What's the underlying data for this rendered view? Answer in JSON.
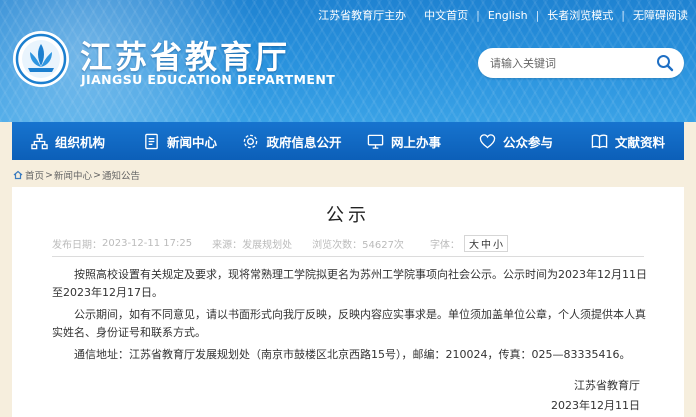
{
  "topbar": {
    "links": [
      "江苏省教育厅主办",
      "中文首页",
      "English",
      "长者浏览模式",
      "无障碍阅读"
    ]
  },
  "brand": {
    "name_cn": "江苏省教育厅",
    "name_en": "JIANGSU EDUCATION DEPARTMENT",
    "logo_icon": "lotus-emblem-icon"
  },
  "search": {
    "placeholder": "请输入关键词",
    "icon": "search-icon"
  },
  "nav": {
    "items": [
      {
        "label": "组织机构",
        "icon": "org-chart-icon"
      },
      {
        "label": "新闻中心",
        "icon": "document-icon"
      },
      {
        "label": "政府信息公开",
        "icon": "gear-icon"
      },
      {
        "label": "网上办事",
        "icon": "monitor-icon"
      },
      {
        "label": "公众参与",
        "icon": "heart-icon"
      },
      {
        "label": "文献资料",
        "icon": "book-icon"
      }
    ]
  },
  "breadcrumb": {
    "items": [
      "首页",
      "新闻中心",
      "通知公告"
    ],
    "separator": ">"
  },
  "article": {
    "title": "公示",
    "meta": {
      "date_label": "发布日期：",
      "date_value": "2023-12-11 17:25",
      "source_label": "来源：",
      "source_value": "发展规划处",
      "views_label": "浏览次数：",
      "views_value": "54627次",
      "font_label": "字体：",
      "font_sizes": [
        "大",
        "中",
        "小"
      ]
    },
    "paragraphs": [
      "按照高校设置有关规定及要求，现将常熟理工学院拟更名为苏州工学院事项向社会公示。公示时间为2023年12月11日至2023年12月17日。",
      "公示期间，如有不同意见，请以书面形式向我厅反映，反映内容应实事求是。单位须加盖单位公章，个人须提供本人真实姓名、身份证号和联系方式。",
      "通信地址：江苏省教育厅发展规划处（南京市鼓楼区北京西路15号），邮编：210024，传真：025—83335416。"
    ],
    "signature": "江苏省教育厅",
    "sign_date": "2023年12月11日"
  },
  "colors": {
    "header_blue": "#2a93de",
    "nav_blue": "#0c5fb8",
    "page_bg": "#f6eedd"
  }
}
